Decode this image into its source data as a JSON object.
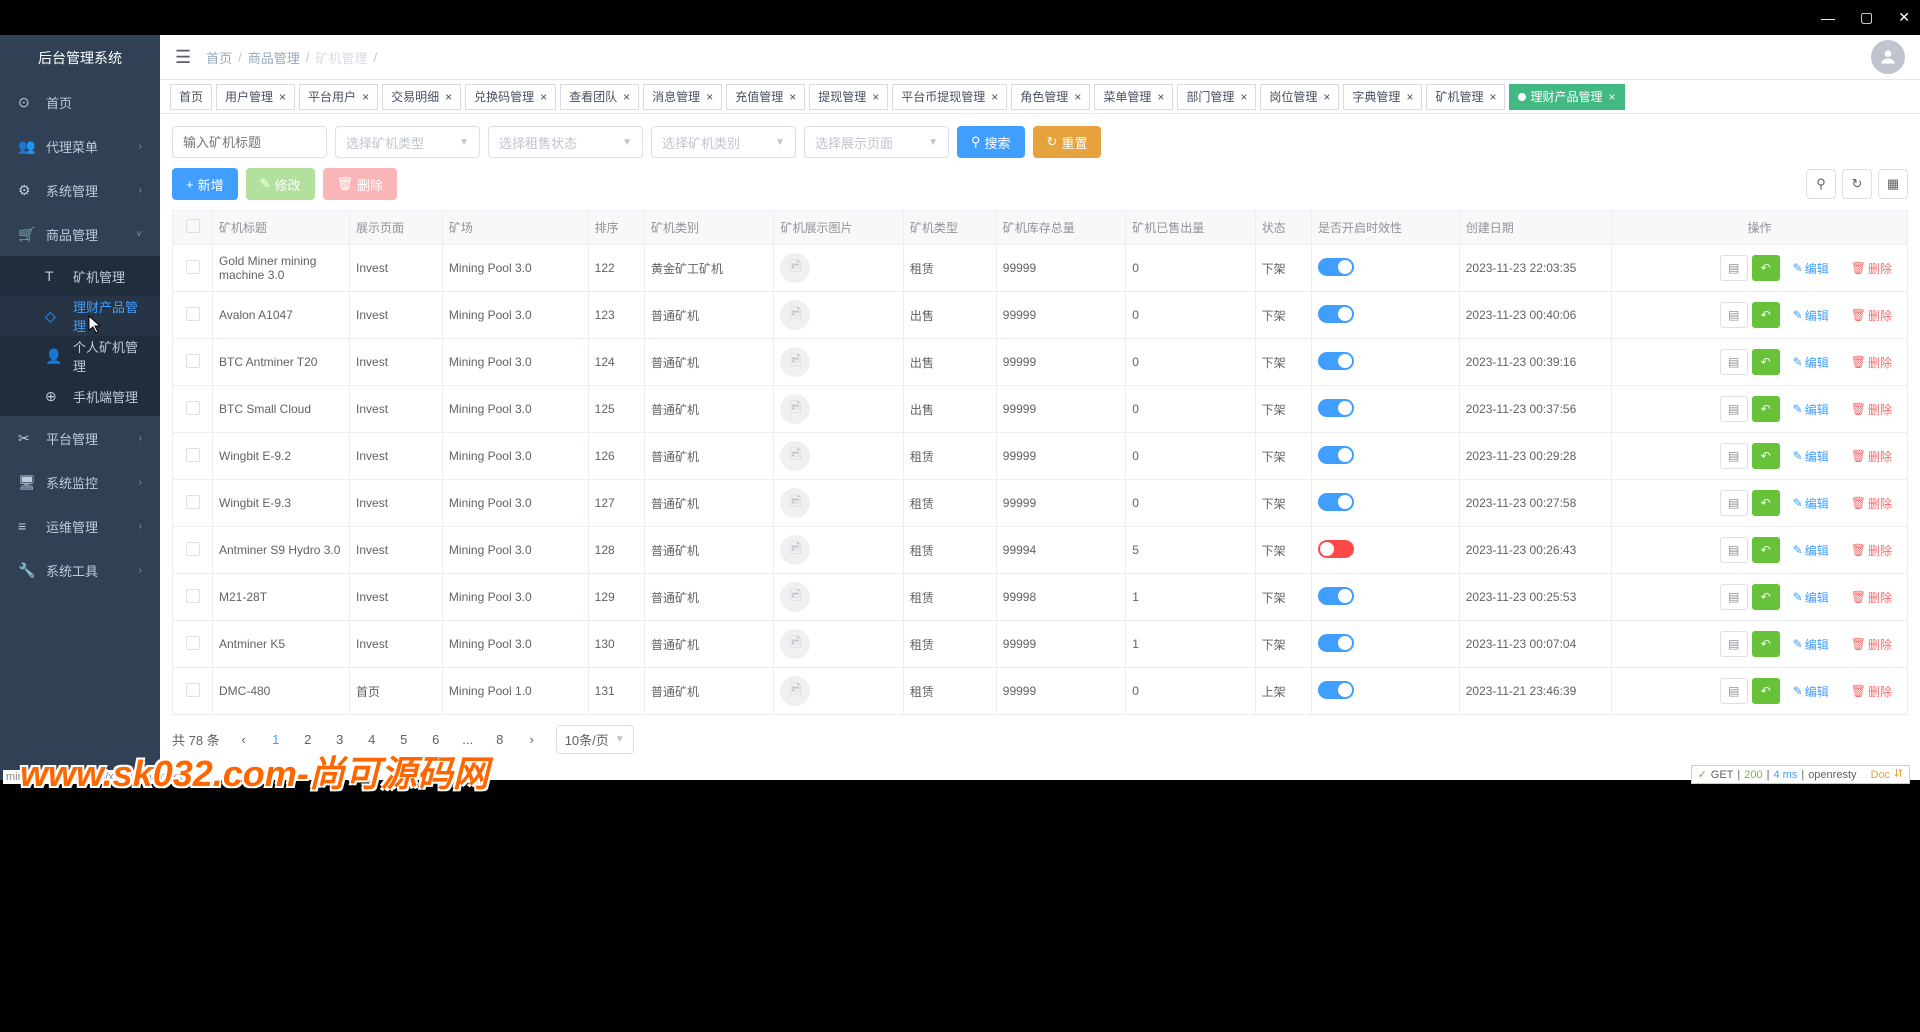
{
  "system_name": "后台管理系统",
  "window_controls": {
    "min": "—",
    "max": "▢",
    "close": "✕"
  },
  "sidebar": [
    {
      "icon": "⊙",
      "label": "首页"
    },
    {
      "icon": "👥",
      "label": "代理菜单",
      "expandable": true
    },
    {
      "icon": "⚙",
      "label": "系统管理",
      "expandable": true
    },
    {
      "icon": "🛒",
      "label": "商品管理",
      "expandable": true,
      "open": true,
      "children": [
        {
          "icon": "T",
          "label": "矿机管理"
        },
        {
          "icon": "◇",
          "label": "理财产品管理",
          "active": true
        },
        {
          "icon": "👤",
          "label": "个人矿机管理"
        },
        {
          "icon": "⊕",
          "label": "手机端管理"
        }
      ]
    },
    {
      "icon": "✂",
      "label": "平台管理",
      "expandable": true
    },
    {
      "icon": "🖥",
      "label": "系统监控",
      "expandable": true
    },
    {
      "icon": "≡",
      "label": "运维管理",
      "expandable": true
    },
    {
      "icon": "🔧",
      "label": "系统工具",
      "expandable": true
    }
  ],
  "breadcrumb": [
    "首页",
    "商品管理",
    "矿机管理"
  ],
  "tabs": [
    {
      "label": "首页"
    },
    {
      "label": "用户管理",
      "closable": true
    },
    {
      "label": "平台用户",
      "closable": true
    },
    {
      "label": "交易明细",
      "closable": true
    },
    {
      "label": "兑换码管理",
      "closable": true
    },
    {
      "label": "查看团队",
      "closable": true
    },
    {
      "label": "消息管理",
      "closable": true
    },
    {
      "label": "充值管理",
      "closable": true
    },
    {
      "label": "提现管理",
      "closable": true
    },
    {
      "label": "平台币提现管理",
      "closable": true
    },
    {
      "label": "角色管理",
      "closable": true
    },
    {
      "label": "菜单管理",
      "closable": true
    },
    {
      "label": "部门管理",
      "closable": true
    },
    {
      "label": "岗位管理",
      "closable": true
    },
    {
      "label": "字典管理",
      "closable": true
    },
    {
      "label": "矿机管理",
      "closable": true
    },
    {
      "label": "理财产品管理",
      "closable": true,
      "active": true
    }
  ],
  "filters": {
    "title_placeholder": "输入矿机标题",
    "type_placeholder": "选择矿机类型",
    "status_placeholder": "选择租售状态",
    "category_placeholder": "选择矿机类别",
    "page_placeholder": "选择展示页面"
  },
  "buttons": {
    "search": "搜索",
    "reset": "重置",
    "add": "新增",
    "edit": "修改",
    "delete": "删除"
  },
  "columns": [
    "",
    "矿机标题",
    "展示页面",
    "矿场",
    "排序",
    "矿机类别",
    "矿机展示图片",
    "矿机类型",
    "矿机库存总量",
    "矿机已售出量",
    "状态",
    "是否开启时效性",
    "创建日期",
    "操作"
  ],
  "rows": [
    {
      "title": "Gold Miner mining machine 3.0",
      "page": "Invest",
      "pool": "Mining Pool 3.0",
      "sort": "122",
      "category": "黄金矿工矿机",
      "type": "租赁",
      "stock": "99999",
      "sold": "0",
      "status": "下架",
      "switch": true,
      "date": "2023-11-23 22:03:35"
    },
    {
      "title": "Avalon A1047",
      "page": "Invest",
      "pool": "Mining Pool 3.0",
      "sort": "123",
      "category": "普通矿机",
      "type": "出售",
      "stock": "99999",
      "sold": "0",
      "status": "下架",
      "switch": true,
      "date": "2023-11-23 00:40:06"
    },
    {
      "title": "BTC Antminer T20",
      "page": "Invest",
      "pool": "Mining Pool 3.0",
      "sort": "124",
      "category": "普通矿机",
      "type": "出售",
      "stock": "99999",
      "sold": "0",
      "status": "下架",
      "switch": true,
      "date": "2023-11-23 00:39:16"
    },
    {
      "title": "BTC Small Cloud",
      "page": "Invest",
      "pool": "Mining Pool 3.0",
      "sort": "125",
      "category": "普通矿机",
      "type": "出售",
      "stock": "99999",
      "sold": "0",
      "status": "下架",
      "switch": true,
      "date": "2023-11-23 00:37:56"
    },
    {
      "title": "Wingbit E-9.2",
      "page": "Invest",
      "pool": "Mining Pool 3.0",
      "sort": "126",
      "category": "普通矿机",
      "type": "租赁",
      "stock": "99999",
      "sold": "0",
      "status": "下架",
      "switch": true,
      "date": "2023-11-23 00:29:28"
    },
    {
      "title": "Wingbit E-9.3",
      "page": "Invest",
      "pool": "Mining Pool 3.0",
      "sort": "127",
      "category": "普通矿机",
      "type": "租赁",
      "stock": "99999",
      "sold": "0",
      "status": "下架",
      "switch": true,
      "date": "2023-11-23 00:27:58"
    },
    {
      "title": "Antminer S9 Hydro 3.0",
      "page": "Invest",
      "pool": "Mining Pool 3.0",
      "sort": "128",
      "category": "普通矿机",
      "type": "租赁",
      "stock": "99994",
      "sold": "5",
      "status": "下架",
      "switch": false,
      "date": "2023-11-23 00:26:43"
    },
    {
      "title": "M21-28T",
      "page": "Invest",
      "pool": "Mining Pool 3.0",
      "sort": "129",
      "category": "普通矿机",
      "type": "租赁",
      "stock": "99998",
      "sold": "1",
      "status": "下架",
      "switch": true,
      "date": "2023-11-23 00:25:53"
    },
    {
      "title": "Antminer K5",
      "page": "Invest",
      "pool": "Mining Pool 3.0",
      "sort": "130",
      "category": "普通矿机",
      "type": "租赁",
      "stock": "99999",
      "sold": "1",
      "status": "下架",
      "switch": true,
      "date": "2023-11-23 00:07:04"
    },
    {
      "title": "DMC-480",
      "page": "首页",
      "pool": "Mining Pool 1.0",
      "sort": "131",
      "category": "普通矿机",
      "type": "租赁",
      "stock": "99999",
      "sold": "0",
      "status": "上架",
      "switch": true,
      "date": "2023-11-21 23:46:39"
    }
  ],
  "row_actions": {
    "edit": "编辑",
    "delete": "删除"
  },
  "pagination": {
    "total_text": "共 78 条",
    "pages": [
      "1",
      "2",
      "3",
      "4",
      "5",
      "6",
      "...",
      "8"
    ],
    "current": "1",
    "size_label": "10条/页"
  },
  "status": {
    "method": "GET",
    "code": "200",
    "time": "4 ms",
    "server": "openresty",
    "doc": "Doc"
  },
  "url_hint": "mining-pool.shop:99/xxx/shop/finxxxx",
  "watermark": "www.sk032.com-尚可源码网"
}
